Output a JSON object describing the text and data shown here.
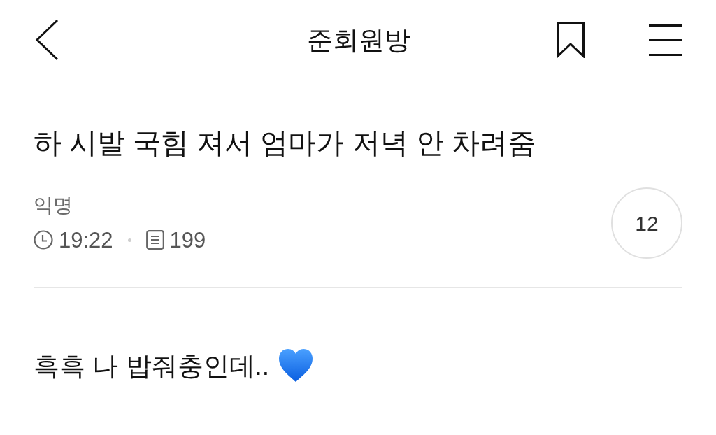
{
  "header": {
    "title": "준회원방"
  },
  "post": {
    "title": "하 시발 국힘 져서 엄마가 저녁 안 차려줌",
    "author": "익명",
    "time": "19:22",
    "views": "199",
    "comment_count": "12",
    "body": "흑흑 나 밥줘충인데.."
  }
}
